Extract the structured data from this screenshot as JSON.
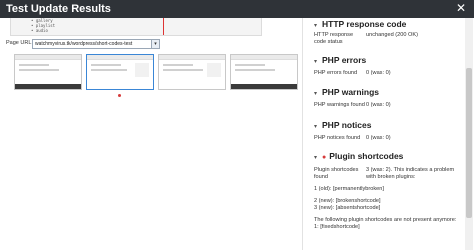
{
  "window": {
    "title": "Test Update Results",
    "close_label": "✕"
  },
  "code_preview": {
    "lines": [
      "• gallery",
      "• playlist",
      "• audio"
    ]
  },
  "page_url": {
    "label": "Page URL",
    "selected": "watchmyvirus.tk/wordpress/short-codes-test",
    "caret": "▾"
  },
  "results": {
    "http": {
      "heading": "HTTP response code",
      "label": "HTTP response code status",
      "value": "unchanged (200 OK)"
    },
    "php_errors": {
      "heading": "PHP errors",
      "label": "PHP errors found",
      "value": "0 (was: 0)"
    },
    "php_warnings": {
      "heading": "PHP warnings",
      "label": "PHP warnings found",
      "value": "0 (was: 0)"
    },
    "php_notices": {
      "heading": "PHP notices",
      "label": "PHP notices found",
      "value": "0 (was: 0)"
    },
    "shortcodes": {
      "heading": "Plugin shortcodes",
      "label": "Plugin shortcodes found",
      "value": "3 (was: 2). This indicates a problem with broken plugins:",
      "old_1": "1 (old): [permanentlybroken]",
      "new_2": "2 (new): [brokenshortcode]",
      "new_3": "3 (new): [absentshortcode]",
      "missing_intro": "The following plugin shortcodes are not present anymore:",
      "missing_1": "1: [fixedshortcode]"
    }
  },
  "icons": {
    "toggle": "▾",
    "bullet": "●"
  },
  "colors": {
    "titlebar": "#2f3338",
    "accent": "#3a86d6",
    "alert": "#d63b3b"
  }
}
